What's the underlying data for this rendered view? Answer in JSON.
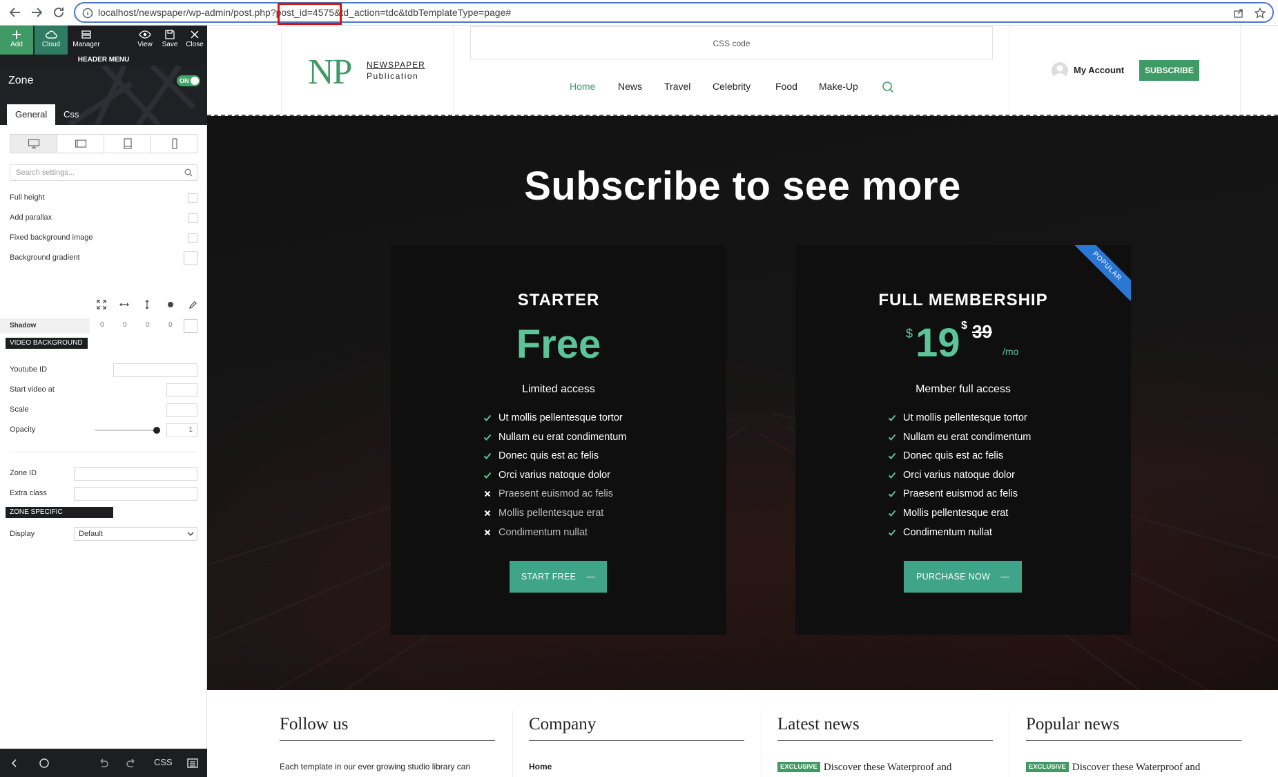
{
  "browser": {
    "url_prefix": "localhost/newspaper/wp-admin/post.php?",
    "url_highlight": "post_id=4575",
    "url_suffix": "&td_action=tdc&tdbTemplateType=page#"
  },
  "editor": {
    "toolbar": {
      "add": "Add",
      "cloud": "Cloud",
      "manager": "Manager",
      "view": "View",
      "save": "Save",
      "close": "Close"
    },
    "context_label": "HEADER MENU",
    "zone_title": "Zone",
    "zone_toggle": "ON",
    "tabs": {
      "general": "General",
      "css": "Css"
    },
    "search_placeholder": "Search settings...",
    "options": {
      "full_height": "Full height",
      "add_parallax": "Add parallax",
      "fixed_bg": "Fixed background image",
      "bg_gradient": "Background gradient"
    },
    "shadow": {
      "label": "Shadow",
      "values": [
        "0",
        "0",
        "0",
        "0"
      ]
    },
    "video_section": "VIDEO BACKGROUND",
    "youtube_id": "Youtube ID",
    "start_video_at": "Start video at",
    "scale": "Scale",
    "opacity": "Opacity",
    "opacity_value": "1",
    "zone_id": "Zone ID",
    "extra_class": "Extra class",
    "zone_params_section": "ZONE SPECIFIC PARAMETERS",
    "display_label": "Display",
    "display_value": "Default",
    "bottom_css": "CSS"
  },
  "header": {
    "logo_np": "NP",
    "logo_line1": "NEWSPAPER",
    "logo_line2": "Publication",
    "css_code": "CSS code",
    "menu": [
      "Home",
      "News",
      "Travel",
      "Celebrity",
      "Food",
      "Make-Up"
    ],
    "account": "My Account",
    "subscribe": "SUBSCRIBE"
  },
  "subscribe": {
    "title": "Subscribe to see more",
    "starter": {
      "name": "STARTER",
      "price": "Free",
      "subtitle": "Limited access",
      "features": [
        {
          "text": "Ut mollis pellentesque tortor",
          "included": true
        },
        {
          "text": "Nullam eu erat condimentum",
          "included": true
        },
        {
          "text": "Donec quis est ac felis",
          "included": true
        },
        {
          "text": "Orci varius natoque dolor",
          "included": true
        },
        {
          "text": "Praesent euismod ac felis",
          "included": false
        },
        {
          "text": "Mollis pellentesque erat",
          "included": false
        },
        {
          "text": "Condimentum nullat",
          "included": false
        }
      ],
      "button": "START FREE"
    },
    "full": {
      "name": "FULL MEMBERSHIP",
      "currency": "$",
      "price": "19",
      "old_currency": "$",
      "old_price": "39",
      "period": "/mo",
      "ribbon": "POPULAR",
      "subtitle": "Member full access",
      "features": [
        {
          "text": "Ut mollis pellentesque tortor",
          "included": true
        },
        {
          "text": "Nullam eu erat condimentum",
          "included": true
        },
        {
          "text": "Donec quis est ac felis",
          "included": true
        },
        {
          "text": "Orci varius natoque dolor",
          "included": true
        },
        {
          "text": "Praesent euismod ac felis",
          "included": true
        },
        {
          "text": "Mollis pellentesque erat",
          "included": true
        },
        {
          "text": "Condimentum nullat",
          "included": true
        }
      ],
      "button": "PURCHASE NOW"
    }
  },
  "footer": {
    "follow_title": "Follow us",
    "follow_text": "Each template in our ever growing studio library can",
    "company_title": "Company",
    "company_first": "Home",
    "latest_title": "Latest news",
    "popular_title": "Popular news",
    "badge": "EXCLUSIVE",
    "news_text": "Discover these Waterproof and"
  },
  "colors": {
    "accent": "#3f9a66",
    "price": "#5bc49a",
    "ribbon": "#2a78d4",
    "button": "#3fa488"
  }
}
